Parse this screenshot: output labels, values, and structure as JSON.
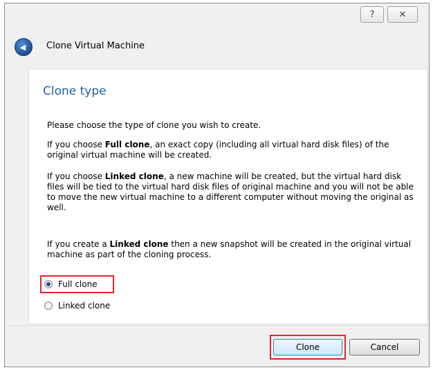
{
  "window": {
    "help_glyph": "?",
    "close_glyph": "✕"
  },
  "wizard": {
    "back_glyph": "◀",
    "title": "Clone Virtual Machine"
  },
  "page": {
    "heading": "Clone type",
    "paragraphs": [
      "Please choose the type of clone you wish to create.",
      "If you choose Full clone, an exact copy (including all virtual hard disk files) of the original virtual machine will be created.",
      "If you choose Linked clone, a new machine will be created, but the virtual hard disk files will be tied to the virtual hard disk files of original machine and you will not be able to move the new virtual machine to a different computer without moving the original as well.",
      "If you create a Linked clone then a new snapshot will be created in the original virtual machine as part of the cloning process."
    ],
    "p2": {
      "a": "If you choose ",
      "b": "Full clone",
      "c": ", an exact copy (including all virtual hard disk files) of the original virtual machine will be created."
    },
    "p3": {
      "a": "If you choose ",
      "b": "Linked clone",
      "c": ", a new machine will be created, but the virtual hard disk files will be tied to the virtual hard disk files of original machine and you will not be able to move the new virtual machine to a different computer without moving the original as well."
    },
    "p4": {
      "a": "If you create a ",
      "b": "Linked clone",
      "c": " then a new snapshot will be created in the original virtual machine as part of the cloning process."
    },
    "options": [
      {
        "label": "Full clone",
        "selected": true
      },
      {
        "label": "Linked clone",
        "selected": false
      }
    ]
  },
  "buttons": {
    "clone": "Clone",
    "cancel": "Cancel"
  },
  "colors": {
    "highlight": "#e0232b",
    "heading": "#1f5fa8"
  }
}
